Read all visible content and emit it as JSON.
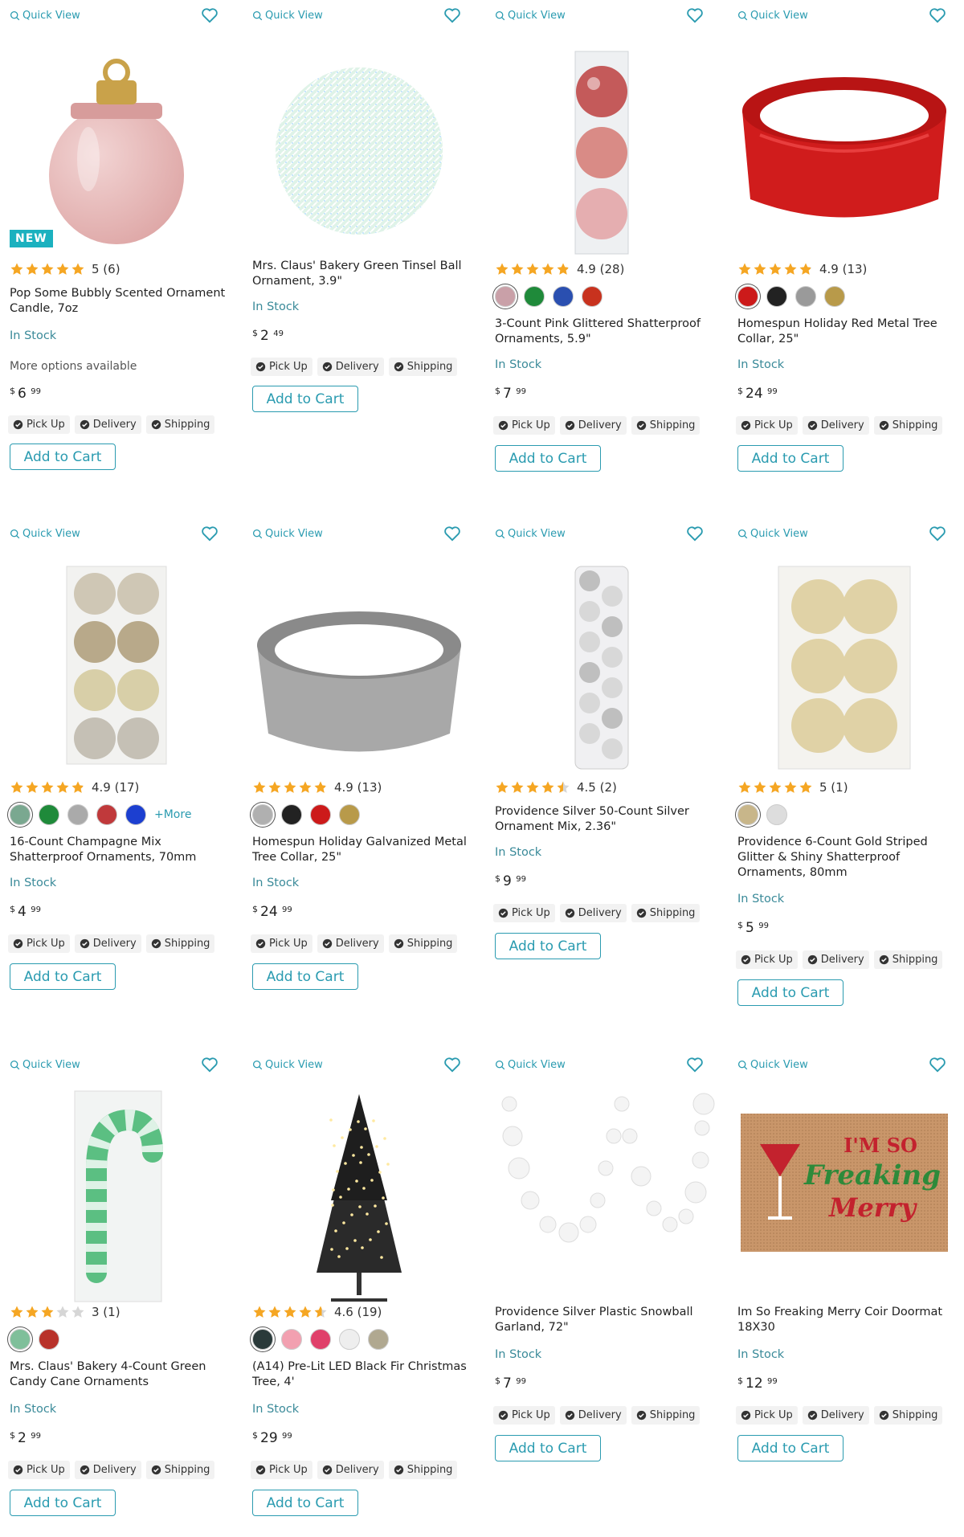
{
  "colors": {
    "accent": "#2a9bb0",
    "new_badge": "#1bb1bf",
    "star": "#f5a623"
  },
  "labels": {
    "quick_view": "Quick View",
    "pick_up": "Pick Up",
    "delivery": "Delivery",
    "shipping": "Shipping",
    "add_to_cart": "Add to Cart",
    "in_stock": "In Stock",
    "new_badge": "NEW",
    "more_options": "More options available",
    "more_swatches": "+More",
    "currency": "$"
  },
  "products": [
    {
      "title": "Pop Some Bubbly Scented Ornament Candle, 7oz",
      "rating": 5,
      "rating_text": "5 (6)",
      "price_dollars": "6",
      "price_cents": "99",
      "image": "pink-glass-ornament-candle",
      "swatches": []
    },
    {
      "title": "Mrs. Claus' Bakery Green Tinsel Ball Ornament, 3.9\"",
      "rating": null,
      "rating_text": "",
      "price_dollars": "2",
      "price_cents": "49",
      "image": "green-tinsel-ball",
      "swatches": []
    },
    {
      "title": "3-Count Pink Glittered Shatterproof Ornaments, 5.9\"",
      "rating": 4.9,
      "rating_text": "4.9 (28)",
      "price_dollars": "7",
      "price_cents": "99",
      "image": "pink-ornament-tube",
      "swatches": [
        "#c9a0a8",
        "#1f8a3a",
        "#2a4fb0",
        "#c8321e"
      ]
    },
    {
      "title": "Homespun Holiday Red Metal Tree Collar, 25\"",
      "rating": 4.9,
      "rating_text": "4.9 (13)",
      "price_dollars": "24",
      "price_cents": "99",
      "image": "red-tree-collar",
      "swatches": [
        "#cc1a1a",
        "#222222",
        "#9a9a9a",
        "#b89a4a"
      ]
    },
    {
      "title": "16-Count Champagne Mix Shatterproof Ornaments, 70mm",
      "rating": 4.9,
      "rating_text": "4.9 (17)",
      "price_dollars": "4",
      "price_cents": "99",
      "image": "champagne-ornament-box",
      "swatches": [
        "#7aa890",
        "#1f8a3a",
        "#aaaaaa",
        "#c0393b",
        "#1c3fd0"
      ]
    },
    {
      "title": "Homespun Holiday Galvanized Metal Tree Collar, 25\"",
      "rating": 4.9,
      "rating_text": "4.9 (13)",
      "price_dollars": "24",
      "price_cents": "99",
      "image": "galvanized-tree-collar",
      "swatches": [
        "#b0b0b0",
        "#222222",
        "#cc1a1a",
        "#b89a4a"
      ]
    },
    {
      "title": "Providence Silver 50-Count Silver Ornament Mix, 2.36\"",
      "rating": 4.5,
      "rating_text": "4.5 (2)",
      "price_dollars": "9",
      "price_cents": "99",
      "image": "silver-ornament-tube",
      "swatches": []
    },
    {
      "title": "Providence 6-Count Gold Striped Glitter & Shiny Shatterproof Ornaments, 80mm",
      "rating": 5,
      "rating_text": "5 (1)",
      "price_dollars": "5",
      "price_cents": "99",
      "image": "gold-ornament-box",
      "swatches": [
        "#c8b68a",
        "#dddddd"
      ]
    },
    {
      "title": "Mrs. Claus' Bakery 4-Count Green Candy Cane Ornaments",
      "rating": 3,
      "rating_text": "3 (1)",
      "price_dollars": "2",
      "price_cents": "99",
      "image": "green-candy-cane",
      "swatches": [
        "#7fbf9a",
        "#b8322a"
      ]
    },
    {
      "title": "(A14) Pre-Lit LED Black Fir Christmas Tree, 4'",
      "rating": 4.6,
      "rating_text": "4.6 (19)",
      "price_dollars": "29",
      "price_cents": "99",
      "image": "black-fir-tree",
      "swatches": [
        "#2a3a3a",
        "#f2a0b0",
        "#e0406a",
        "#eeeeee",
        "#b0a890"
      ]
    },
    {
      "title": "Providence Silver Plastic Snowball Garland, 72\"",
      "rating": null,
      "rating_text": "",
      "price_dollars": "7",
      "price_cents": "99",
      "image": "snowball-garland",
      "swatches": []
    },
    {
      "title": "Im So Freaking Merry Coir Doormat 18X30",
      "rating": null,
      "rating_text": "",
      "price_dollars": "12",
      "price_cents": "99",
      "image": "freaking-merry-doormat",
      "swatches": []
    }
  ],
  "doormat": {
    "line1": "I'M SO",
    "line2": "Freaking",
    "line3": "Merry"
  }
}
